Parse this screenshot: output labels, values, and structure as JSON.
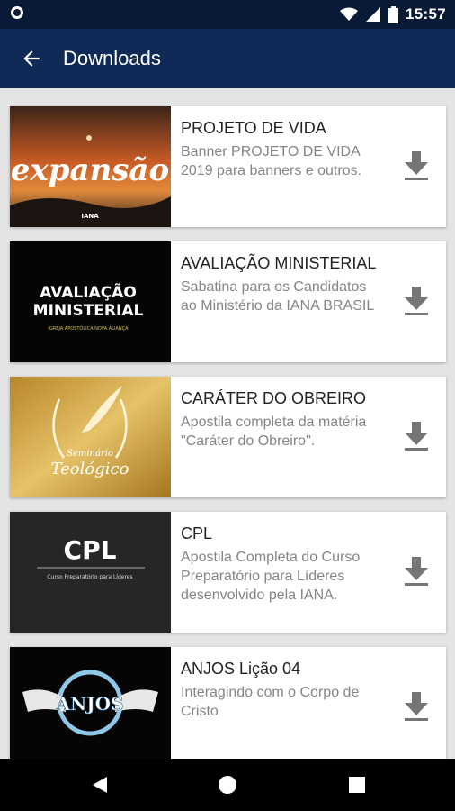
{
  "status_bar": {
    "time": "15:57",
    "icons": [
      "notification-circle-icon",
      "wifi-icon",
      "signal-icon",
      "battery-icon"
    ]
  },
  "app_bar": {
    "title": "Downloads",
    "back_icon": "arrow-back-icon"
  },
  "downloads": [
    {
      "title": "PROJETO DE VIDA",
      "description": "Banner PROJETO DE VIDA 2019 para banners e outros.",
      "thumbnail_text": "expansão",
      "thumbnail_logo": "IANA"
    },
    {
      "title": "AVALIAÇÃO MINISTERIAL",
      "description": "Sabatina para os Candidatos ao Ministério da IANA BRASIL",
      "thumbnail_text_line1": "AVALIAÇÃO",
      "thumbnail_text_line2": "MINISTERIAL",
      "thumbnail_caption": "IGREJA APOSTÓLICA NOVA ALIANÇA"
    },
    {
      "title": "CARÁTER DO OBREIRO",
      "description": "Apostila completa da matéria \"Caráter do Obreiro\".",
      "thumbnail_text_line1": "Seminário",
      "thumbnail_text_line2": "Teológico"
    },
    {
      "title": "CPL",
      "description": "Apostila Completa do Curso Preparatório para Líderes desenvolvido pela IANA.",
      "thumbnail_text": "CPL",
      "thumbnail_caption": "Curso Preparatório para Líderes"
    },
    {
      "title": "ANJOS Lição 04",
      "description": "Interagindo com o Corpo de Cristo",
      "thumbnail_text": "ANJOS"
    }
  ],
  "download_icon": "download-icon",
  "nav_bar": [
    "back-triangle-icon",
    "home-circle-icon",
    "recents-square-icon"
  ],
  "colors": {
    "status_bar": "#091a36",
    "app_bar": "#0f2a56",
    "background": "#e4e4e4",
    "title_text": "#222222",
    "description_text": "#858585",
    "icon": "#757575"
  }
}
